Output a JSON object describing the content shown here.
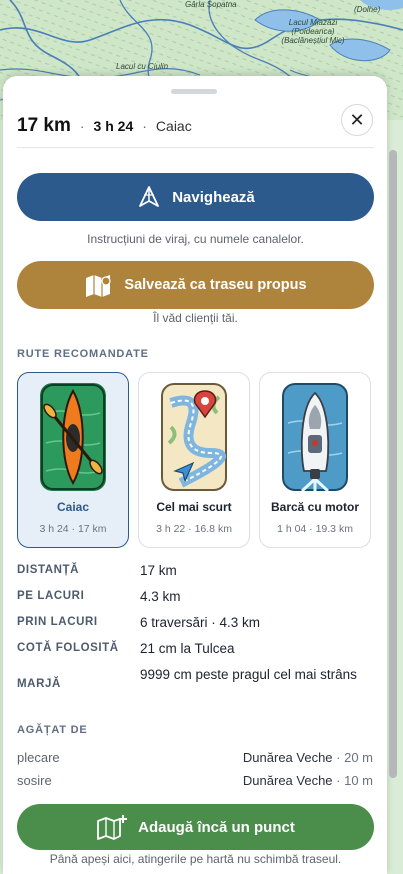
{
  "map": {
    "labels": [
      "Gârla Șopatna",
      "Lacul Miazăzi (Poideanca) (Baclâneștiul Mic)",
      "Lacul cu Ciulin",
      "(Dolhe)"
    ]
  },
  "header": {
    "distance": "17 km",
    "duration": "3 h 24",
    "mode": "Caiac",
    "close_icon": "close-icon"
  },
  "actions": {
    "navigate_label": "Navighează",
    "navigate_note": "Instrucțiuni de viraj, cu numele canalelor.",
    "save_label": "Salvează ca traseu propus",
    "save_note": "Îl văd clienții tăi.",
    "add_label": "Adaugă încă un punct",
    "add_note": "Până apeși aici, atingerile pe hartă nu schimbă traseul."
  },
  "routes": {
    "section_title": "RUTE RECOMANDATE",
    "items": [
      {
        "title": "Caiac",
        "sub": "3 h 24 · 17 km",
        "selected": true
      },
      {
        "title": "Cel mai scurt",
        "sub": "3 h 22 · 16.8 km",
        "selected": false
      },
      {
        "title": "Barcă cu motor",
        "sub": "1 h 04 · 19.3 km",
        "selected": false
      }
    ]
  },
  "details": [
    {
      "key": "DISTANȚĂ",
      "value": "17 km"
    },
    {
      "key": "PE LACURI",
      "value": "4.3 km"
    },
    {
      "key": "PRIN LACURI",
      "value": "6 traversări · 4.3 km"
    },
    {
      "key": "COTĂ FOLOSITĂ",
      "value": "21 cm la Tulcea"
    },
    {
      "key": "MARJĂ",
      "value": "9999 cm peste pragul cel mai strâns"
    }
  ],
  "attached": {
    "section_title": "AGĂȚAT DE",
    "start_label": "plecare",
    "start_value": "Dunărea Veche",
    "start_dist": " · 20 m",
    "end_label": "sosire",
    "end_value": "Dunărea Veche",
    "end_dist": " · 10 m"
  },
  "colors": {
    "navigate": "#2d5a8c",
    "save": "#ae843d",
    "add": "#4b8d4a"
  }
}
